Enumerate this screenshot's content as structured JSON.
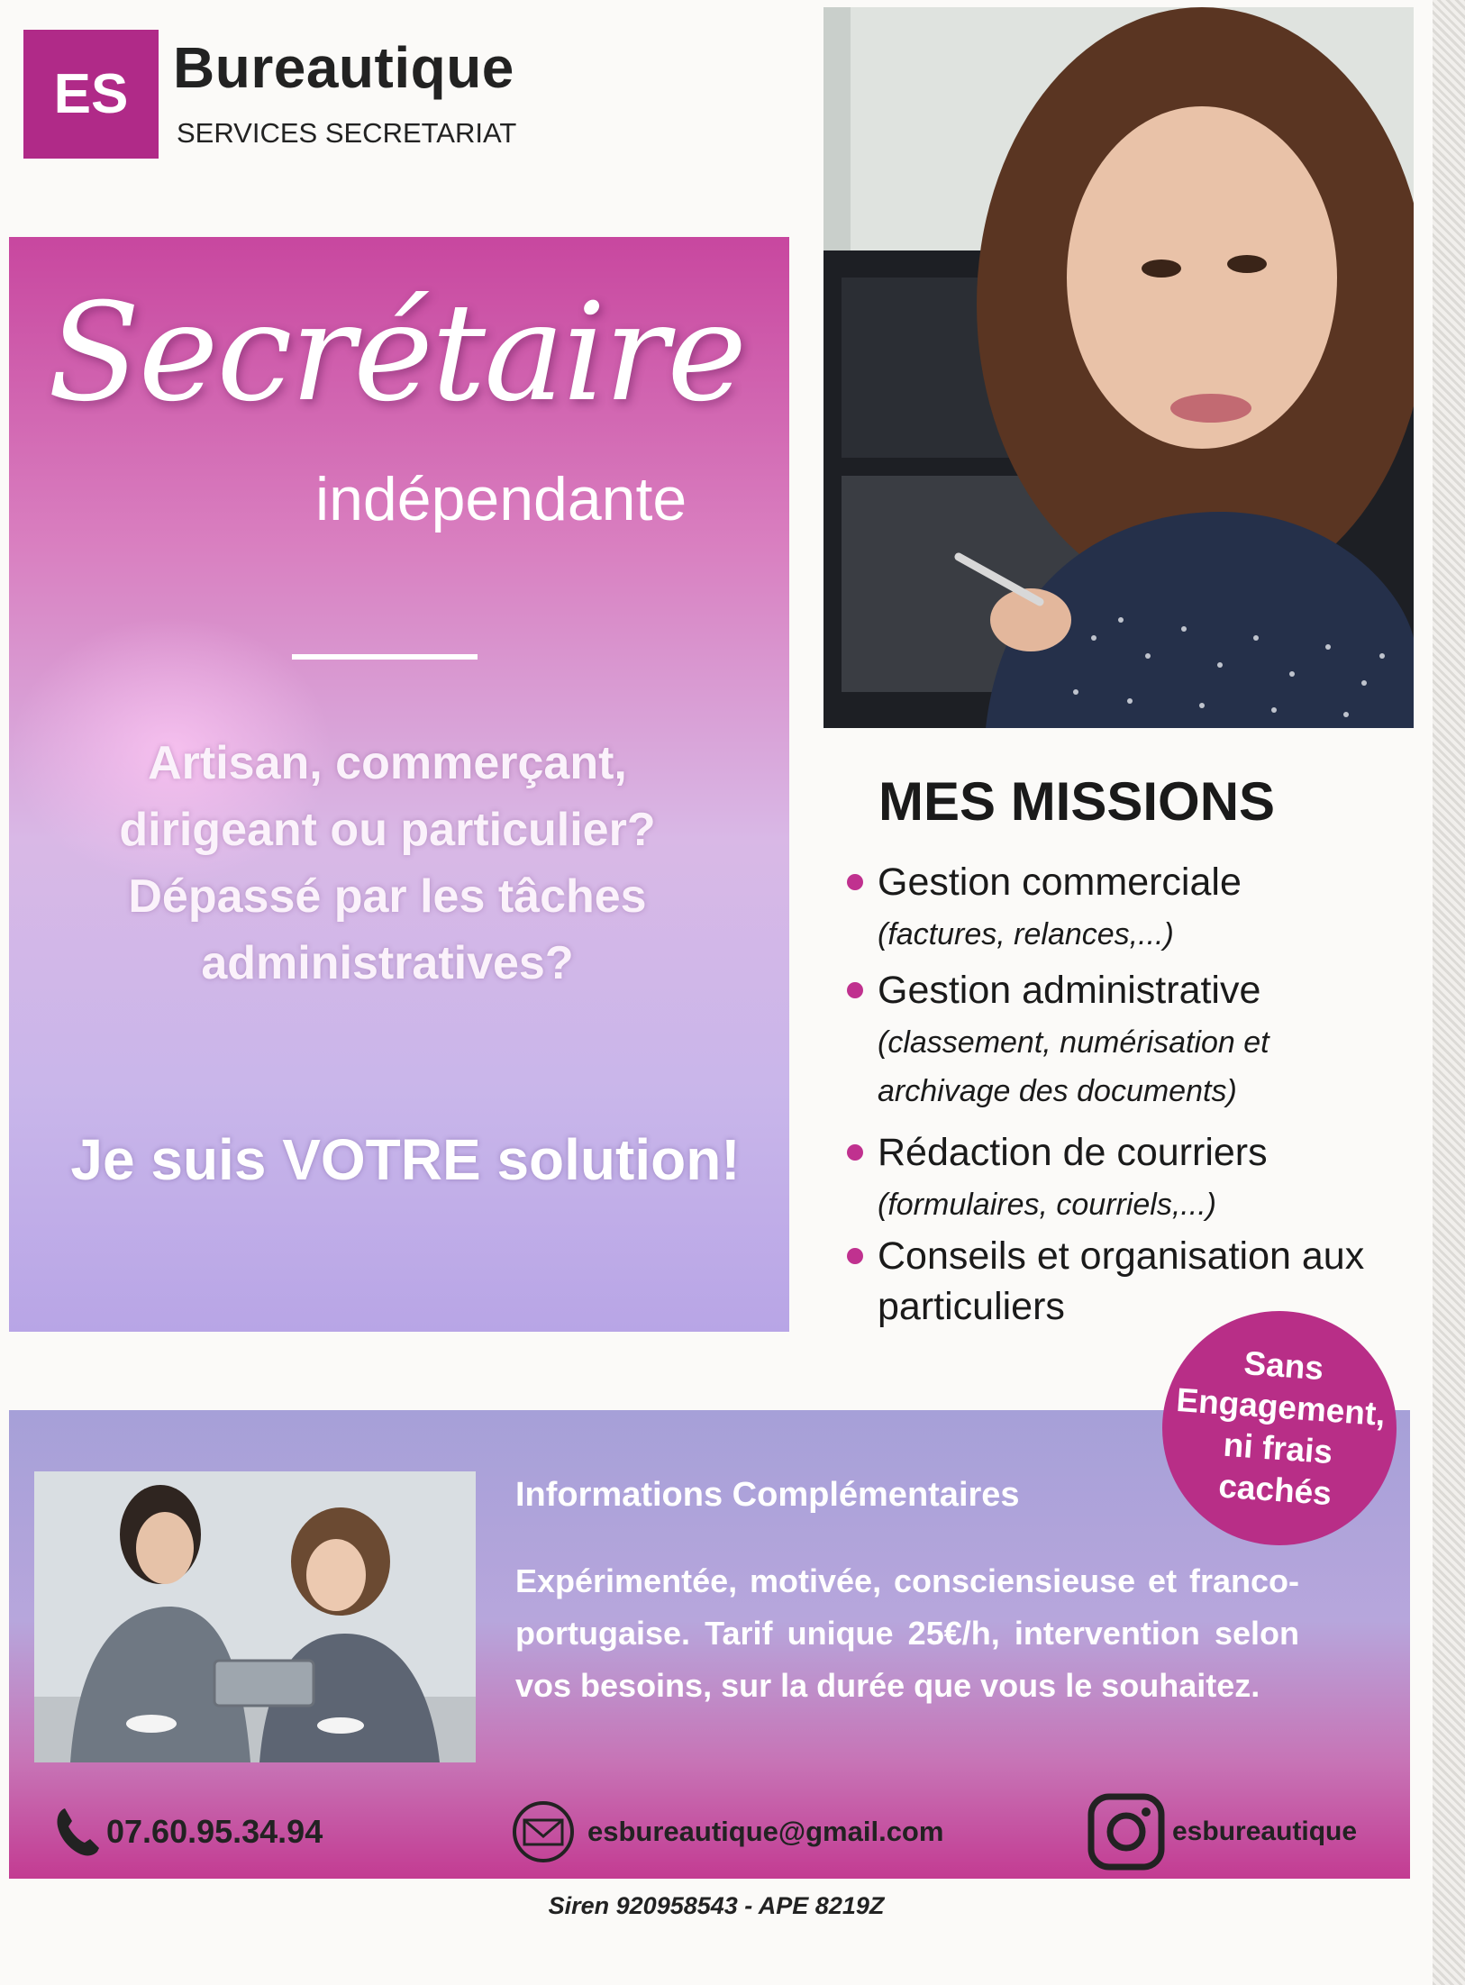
{
  "logo": {
    "mark": "ES",
    "name": "Bureautique",
    "tagline": "SERVICES SECRETARIAT"
  },
  "hero": {
    "title": "Secrétaire",
    "subtitle": "indépendante",
    "question_lines": [
      "Artisan, commerçant,",
      "dirigeant ou particulier?",
      "Dépassé par les tâches",
      "administratives?"
    ],
    "solution": "Je suis VOTRE solution!"
  },
  "missions": {
    "heading": "MES MISSIONS",
    "items": [
      {
        "title": "Gestion commerciale",
        "detail": "(factures, relances,...)"
      },
      {
        "title": "Gestion administrative",
        "detail": "(classement, numérisation et archivage des documents)"
      },
      {
        "title": "Rédaction de courriers",
        "detail": "(formulaires, courriels,...)"
      },
      {
        "title": "Conseils et organisation aux",
        "detail": "particuliers"
      }
    ]
  },
  "badge": {
    "lines": [
      "Sans",
      "Engagement,",
      "ni frais",
      "cachés"
    ]
  },
  "info": {
    "heading": "Informations Complémentaires",
    "body": "Expérimentée, motivée, consciensieuse et franco-portugaise. Tarif unique 25€/h, intervention selon vos besoins, sur la durée que vous le souhaitez."
  },
  "contact": {
    "phone": "07.60.95.34.94",
    "email": "esbureautique@gmail.com",
    "instagram": "esbureautique"
  },
  "footer": {
    "siren": "Siren 920958543  - APE  8219Z"
  },
  "colors": {
    "brand": "#b02a88",
    "accent": "#c0318f"
  }
}
